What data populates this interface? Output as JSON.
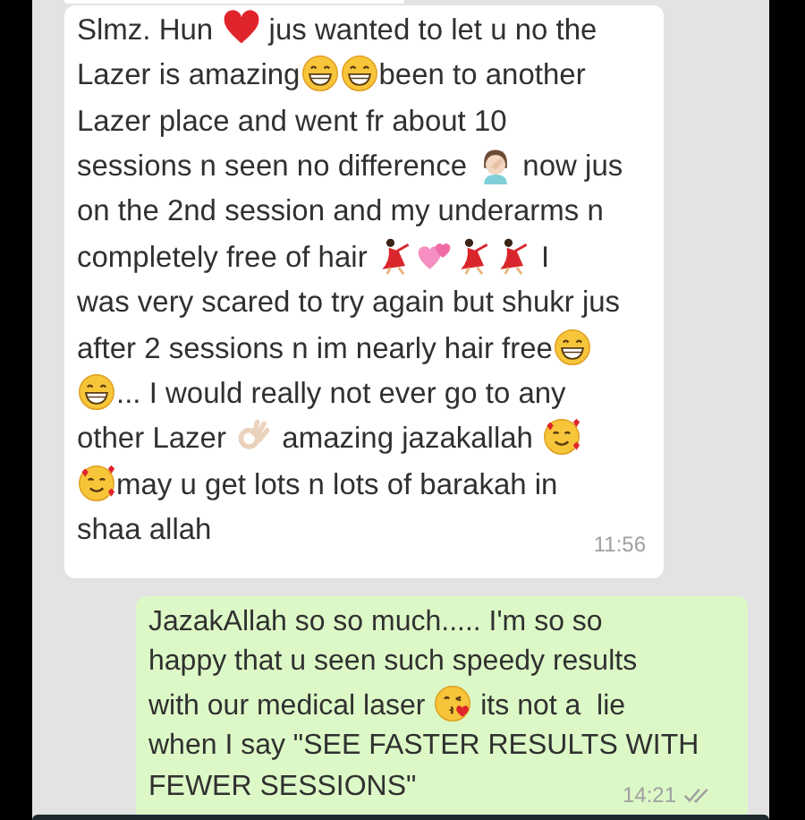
{
  "messages": [
    {
      "kind": "incoming",
      "time": "11:56",
      "lines": [
        [
          {
            "kind": "text",
            "text": "Slmz. Hun "
          },
          {
            "kind": "heart"
          },
          {
            "kind": "text",
            "text": " jus wanted to let u no the"
          }
        ],
        [
          {
            "kind": "text",
            "text": "Lazer is amazing"
          },
          {
            "kind": "grin"
          },
          {
            "kind": "grin"
          },
          {
            "kind": "text",
            "text": "been to another"
          }
        ],
        [
          {
            "kind": "text",
            "text": "Lazer place and went fr about 10"
          }
        ],
        [
          {
            "kind": "text",
            "text": "sessions n seen no difference "
          },
          {
            "kind": "facepalm"
          },
          {
            "kind": "text",
            "text": " now jus"
          }
        ],
        [
          {
            "kind": "text",
            "text": "on the 2nd session and my underarms n"
          }
        ],
        [
          {
            "kind": "text",
            "text": "completely free of hair "
          },
          {
            "kind": "dancer"
          },
          {
            "kind": "hearts"
          },
          {
            "kind": "dancer"
          },
          {
            "kind": "dancer"
          },
          {
            "kind": "text",
            "text": " I"
          }
        ],
        [
          {
            "kind": "text",
            "text": "was very scared to try again but shukr jus"
          }
        ],
        [
          {
            "kind": "text",
            "text": "after 2 sessions n im nearly hair free"
          },
          {
            "kind": "grin"
          }
        ],
        [
          {
            "kind": "grin"
          },
          {
            "kind": "text",
            "text": "... I would really not ever go to any"
          }
        ],
        [
          {
            "kind": "text",
            "text": "other Lazer "
          },
          {
            "kind": "ok"
          },
          {
            "kind": "text",
            "text": " amazing jazakallah "
          },
          {
            "kind": "love"
          }
        ],
        [
          {
            "kind": "love"
          },
          {
            "kind": "text",
            "text": "may u get lots n lots of barakah in"
          }
        ],
        [
          {
            "kind": "text",
            "text": "shaa allah"
          }
        ]
      ]
    },
    {
      "kind": "outgoing",
      "time": "14:21",
      "lines": [
        [
          {
            "kind": "text",
            "text": "JazakAllah so so much..... I'm so so"
          }
        ],
        [
          {
            "kind": "text",
            "text": "happy that u seen such speedy results"
          }
        ],
        [
          {
            "kind": "text",
            "text": "with our medical laser "
          },
          {
            "kind": "kiss"
          },
          {
            "kind": "text",
            "text": " its not a  lie"
          }
        ],
        [
          {
            "kind": "text",
            "text": "when I say \"SEE FASTER RESULTS WITH"
          }
        ],
        [
          {
            "kind": "text",
            "text": "FEWER SESSIONS\""
          }
        ]
      ]
    }
  ]
}
